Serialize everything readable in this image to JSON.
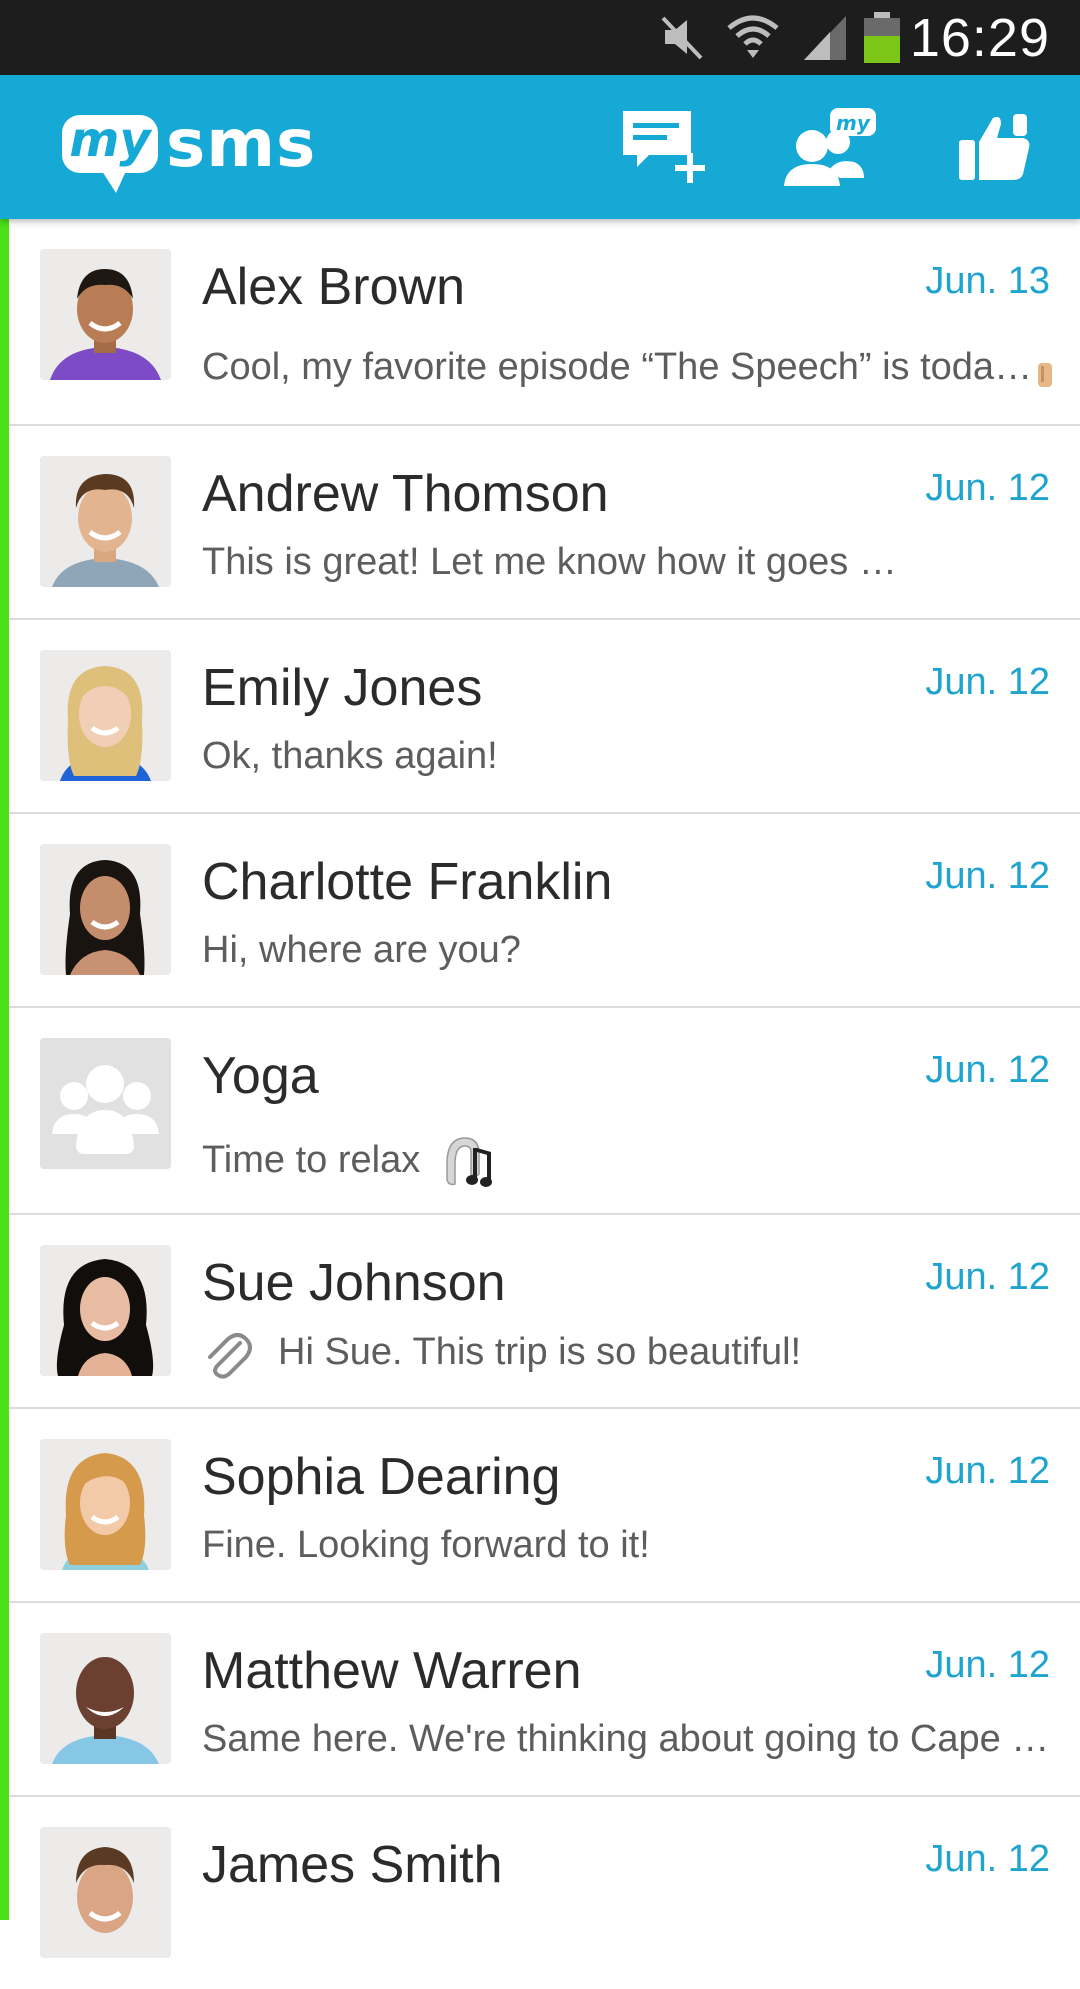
{
  "status_bar": {
    "time": "16:29",
    "icons": [
      "mute-icon",
      "wifi-icon",
      "signal-icon",
      "battery-icon"
    ]
  },
  "app_bar": {
    "logo_bubble": "my",
    "logo_word": "sms",
    "actions": [
      {
        "name": "new-message-icon"
      },
      {
        "name": "mysms-contacts-icon"
      },
      {
        "name": "thumbs-up-icon"
      }
    ],
    "accent_color": "#17a9d6"
  },
  "colors": {
    "unread_indicator": "#4ce016",
    "date": "#1fa3cf"
  },
  "conversations": [
    {
      "name": "Alex Brown",
      "date": "Jun. 13",
      "snippet": "Cool, my favorite episode “The Speech” is toda…"
    },
    {
      "name": "Andrew Thomson",
      "date": "Jun. 12",
      "snippet": "This is great! Let me know how it goes …"
    },
    {
      "name": "Emily Jones",
      "date": "Jun. 12",
      "snippet": "Ok, thanks again!"
    },
    {
      "name": "Charlotte Franklin",
      "date": "Jun. 12",
      "snippet": "Hi, where are you?"
    },
    {
      "name": "Yoga",
      "date": "Jun. 12",
      "snippet": "Time to relax"
    },
    {
      "name": "Sue Johnson",
      "date": "Jun. 12",
      "snippet": "Hi Sue. This trip is so beautiful!"
    },
    {
      "name": "Sophia Dearing",
      "date": "Jun. 12",
      "snippet": "Fine. Looking forward to it!"
    },
    {
      "name": "Matthew Warren",
      "date": "Jun. 12",
      "snippet": "Same here. We're thinking about going to Cape …"
    },
    {
      "name": "James Smith",
      "date": "Jun. 12",
      "snippet": ""
    }
  ]
}
